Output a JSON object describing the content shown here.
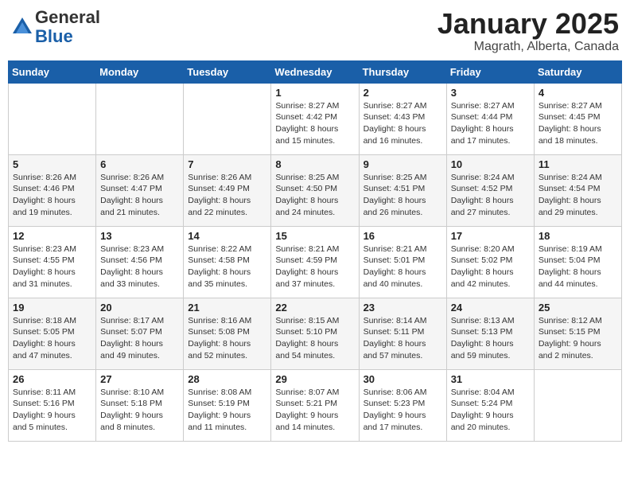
{
  "header": {
    "logo_general": "General",
    "logo_blue": "Blue",
    "month_title": "January 2025",
    "location": "Magrath, Alberta, Canada"
  },
  "weekdays": [
    "Sunday",
    "Monday",
    "Tuesday",
    "Wednesday",
    "Thursday",
    "Friday",
    "Saturday"
  ],
  "weeks": [
    [
      {
        "day": "",
        "info": ""
      },
      {
        "day": "",
        "info": ""
      },
      {
        "day": "",
        "info": ""
      },
      {
        "day": "1",
        "info": "Sunrise: 8:27 AM\nSunset: 4:42 PM\nDaylight: 8 hours\nand 15 minutes."
      },
      {
        "day": "2",
        "info": "Sunrise: 8:27 AM\nSunset: 4:43 PM\nDaylight: 8 hours\nand 16 minutes."
      },
      {
        "day": "3",
        "info": "Sunrise: 8:27 AM\nSunset: 4:44 PM\nDaylight: 8 hours\nand 17 minutes."
      },
      {
        "day": "4",
        "info": "Sunrise: 8:27 AM\nSunset: 4:45 PM\nDaylight: 8 hours\nand 18 minutes."
      }
    ],
    [
      {
        "day": "5",
        "info": "Sunrise: 8:26 AM\nSunset: 4:46 PM\nDaylight: 8 hours\nand 19 minutes."
      },
      {
        "day": "6",
        "info": "Sunrise: 8:26 AM\nSunset: 4:47 PM\nDaylight: 8 hours\nand 21 minutes."
      },
      {
        "day": "7",
        "info": "Sunrise: 8:26 AM\nSunset: 4:49 PM\nDaylight: 8 hours\nand 22 minutes."
      },
      {
        "day": "8",
        "info": "Sunrise: 8:25 AM\nSunset: 4:50 PM\nDaylight: 8 hours\nand 24 minutes."
      },
      {
        "day": "9",
        "info": "Sunrise: 8:25 AM\nSunset: 4:51 PM\nDaylight: 8 hours\nand 26 minutes."
      },
      {
        "day": "10",
        "info": "Sunrise: 8:24 AM\nSunset: 4:52 PM\nDaylight: 8 hours\nand 27 minutes."
      },
      {
        "day": "11",
        "info": "Sunrise: 8:24 AM\nSunset: 4:54 PM\nDaylight: 8 hours\nand 29 minutes."
      }
    ],
    [
      {
        "day": "12",
        "info": "Sunrise: 8:23 AM\nSunset: 4:55 PM\nDaylight: 8 hours\nand 31 minutes."
      },
      {
        "day": "13",
        "info": "Sunrise: 8:23 AM\nSunset: 4:56 PM\nDaylight: 8 hours\nand 33 minutes."
      },
      {
        "day": "14",
        "info": "Sunrise: 8:22 AM\nSunset: 4:58 PM\nDaylight: 8 hours\nand 35 minutes."
      },
      {
        "day": "15",
        "info": "Sunrise: 8:21 AM\nSunset: 4:59 PM\nDaylight: 8 hours\nand 37 minutes."
      },
      {
        "day": "16",
        "info": "Sunrise: 8:21 AM\nSunset: 5:01 PM\nDaylight: 8 hours\nand 40 minutes."
      },
      {
        "day": "17",
        "info": "Sunrise: 8:20 AM\nSunset: 5:02 PM\nDaylight: 8 hours\nand 42 minutes."
      },
      {
        "day": "18",
        "info": "Sunrise: 8:19 AM\nSunset: 5:04 PM\nDaylight: 8 hours\nand 44 minutes."
      }
    ],
    [
      {
        "day": "19",
        "info": "Sunrise: 8:18 AM\nSunset: 5:05 PM\nDaylight: 8 hours\nand 47 minutes."
      },
      {
        "day": "20",
        "info": "Sunrise: 8:17 AM\nSunset: 5:07 PM\nDaylight: 8 hours\nand 49 minutes."
      },
      {
        "day": "21",
        "info": "Sunrise: 8:16 AM\nSunset: 5:08 PM\nDaylight: 8 hours\nand 52 minutes."
      },
      {
        "day": "22",
        "info": "Sunrise: 8:15 AM\nSunset: 5:10 PM\nDaylight: 8 hours\nand 54 minutes."
      },
      {
        "day": "23",
        "info": "Sunrise: 8:14 AM\nSunset: 5:11 PM\nDaylight: 8 hours\nand 57 minutes."
      },
      {
        "day": "24",
        "info": "Sunrise: 8:13 AM\nSunset: 5:13 PM\nDaylight: 8 hours\nand 59 minutes."
      },
      {
        "day": "25",
        "info": "Sunrise: 8:12 AM\nSunset: 5:15 PM\nDaylight: 9 hours\nand 2 minutes."
      }
    ],
    [
      {
        "day": "26",
        "info": "Sunrise: 8:11 AM\nSunset: 5:16 PM\nDaylight: 9 hours\nand 5 minutes."
      },
      {
        "day": "27",
        "info": "Sunrise: 8:10 AM\nSunset: 5:18 PM\nDaylight: 9 hours\nand 8 minutes."
      },
      {
        "day": "28",
        "info": "Sunrise: 8:08 AM\nSunset: 5:19 PM\nDaylight: 9 hours\nand 11 minutes."
      },
      {
        "day": "29",
        "info": "Sunrise: 8:07 AM\nSunset: 5:21 PM\nDaylight: 9 hours\nand 14 minutes."
      },
      {
        "day": "30",
        "info": "Sunrise: 8:06 AM\nSunset: 5:23 PM\nDaylight: 9 hours\nand 17 minutes."
      },
      {
        "day": "31",
        "info": "Sunrise: 8:04 AM\nSunset: 5:24 PM\nDaylight: 9 hours\nand 20 minutes."
      },
      {
        "day": "",
        "info": ""
      }
    ]
  ]
}
